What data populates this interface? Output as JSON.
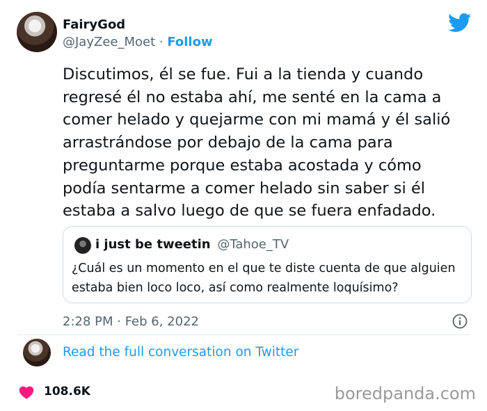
{
  "author": {
    "display_name": "FairyGod",
    "handle": "@JayZee_Moet",
    "separator": " · ",
    "follow_label": "Follow"
  },
  "tweet": {
    "lines": [
      "Discutimos, él se fue. Fui a la tienda y cuando",
      "regresé él no estaba ahí, me senté en la cama a",
      "comer helado y quejarme con mi mamá y él salió",
      "arrastrándose por debajo de la cama para",
      "preguntarme porque estaba acostada y cómo",
      "podía sentarme a comer helado sin saber si él",
      "estaba a salvo luego de que se fuera enfadado."
    ],
    "timestamp": "2:28 PM · Feb 6, 2022"
  },
  "quoted_tweet": {
    "name": "i just be tweetin",
    "handle": "@Tahoe_TV",
    "lines": [
      "¿Cuál es un momento en el que te diste cuenta de que alguien",
      "estaba bien loco loco, así como realmente loquísimo?"
    ]
  },
  "footer": {
    "read_full_label": "Read the full conversation on Twitter",
    "like_count": "108.6K"
  },
  "watermark": "boredpanda.com",
  "colors": {
    "accent": "#1d9bf0",
    "heart": "#f91880",
    "secondary_text": "#536471"
  },
  "icons": [
    "twitter-bird-icon",
    "info-icon",
    "heart-icon"
  ]
}
